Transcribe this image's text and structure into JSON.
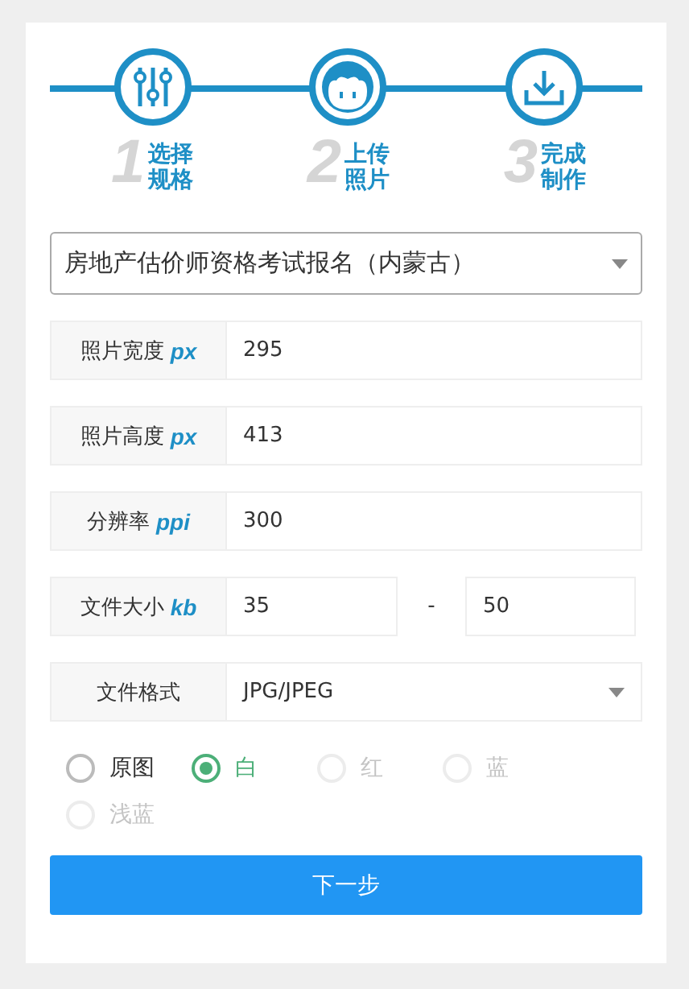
{
  "steps": [
    {
      "number": "1",
      "label": "选择规格",
      "kind": "sliders"
    },
    {
      "number": "2",
      "label": "上传照片",
      "kind": "face"
    },
    {
      "number": "3",
      "label": "完成制作",
      "kind": "download"
    }
  ],
  "exam_select": {
    "value": "房地产估价师资格考试报名（内蒙古）"
  },
  "fields": [
    {
      "kind": "single",
      "label": "照片宽度",
      "unit": "px",
      "value": "295"
    },
    {
      "kind": "single",
      "label": "照片高度",
      "unit": "px",
      "value": "413"
    },
    {
      "kind": "single",
      "label": "分辨率",
      "unit": "ppi",
      "value": "300"
    },
    {
      "kind": "range",
      "label": "文件大小",
      "unit": "kb",
      "value": "35",
      "separator": "-",
      "value_max": "50"
    },
    {
      "kind": "select",
      "label": "文件格式",
      "value": "JPG/JPEG"
    }
  ],
  "background_colors": [
    {
      "label": "原图",
      "selected": false,
      "disabled": false
    },
    {
      "label": "白",
      "selected": true,
      "disabled": false
    },
    {
      "label": "红",
      "selected": false,
      "disabled": true
    },
    {
      "label": "蓝",
      "selected": false,
      "disabled": true
    },
    {
      "label": "浅蓝",
      "selected": false,
      "disabled": true
    }
  ],
  "next_button": "下一步"
}
